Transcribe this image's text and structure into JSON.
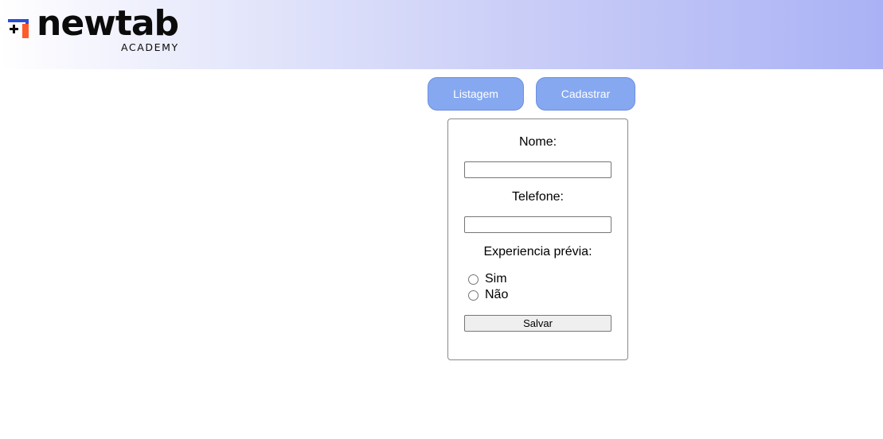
{
  "brand": {
    "name": "newtab",
    "subtitle": "ACADEMY",
    "icon": "plus-bracket-logo-icon"
  },
  "nav": {
    "list_label": "Listagem",
    "register_label": "Cadastrar"
  },
  "form": {
    "name_label": "Nome:",
    "name_value": "",
    "phone_label": "Telefone:",
    "phone_value": "",
    "experience_label": "Experiencia prévia:",
    "options": [
      {
        "label": "Sim",
        "checked": false
      },
      {
        "label": "Não",
        "checked": false
      }
    ],
    "save_label": "Salvar"
  },
  "colors": {
    "nav_button": "#86a8f0",
    "logo_blue": "#2b4fd8",
    "logo_orange": "#ff5a2a"
  }
}
